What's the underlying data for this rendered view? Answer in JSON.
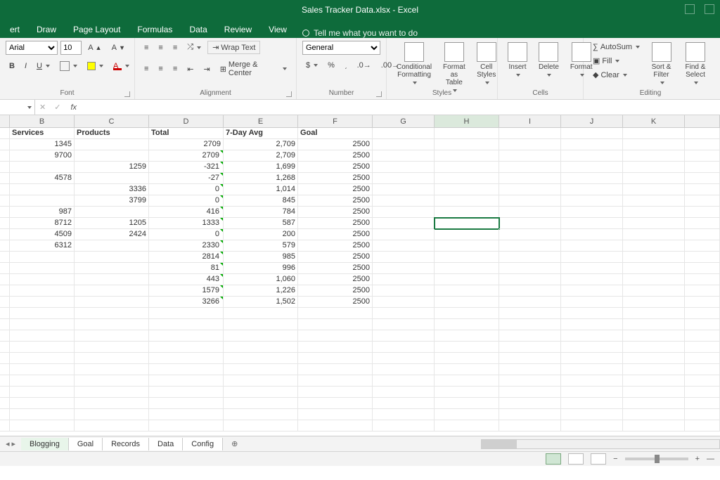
{
  "title": "Sales Tracker Data.xlsx - Excel",
  "menu": {
    "tabs": [
      "ert",
      "Draw",
      "Page Layout",
      "Formulas",
      "Data",
      "Review",
      "View"
    ],
    "tell": "Tell me what you want to do"
  },
  "ribbon": {
    "font": {
      "name": "Arial",
      "size": "10",
      "bold": "B",
      "italic": "I",
      "underline": "U",
      "label": "Font"
    },
    "alignment": {
      "wrap": "Wrap Text",
      "merge": "Merge & Center",
      "label": "Alignment"
    },
    "number": {
      "format": "General",
      "label": "Number"
    },
    "styles": {
      "cond": "Conditional Formatting",
      "fat": "Format as Table",
      "cst": "Cell Styles",
      "label": "Styles"
    },
    "cells": {
      "insert": "Insert",
      "delete": "Delete",
      "format": "Format",
      "label": "Cells"
    },
    "editing": {
      "autosum": "AutoSum",
      "fill": "Fill",
      "clear": "Clear",
      "sort": "Sort & Filter",
      "find": "Find & Select",
      "label": "Editing"
    }
  },
  "formulabar": {
    "name": "",
    "fx": "fx"
  },
  "columns": [
    "B",
    "C",
    "D",
    "E",
    "F",
    "G",
    "H",
    "I",
    "J",
    "K"
  ],
  "headers": {
    "B": "Services",
    "C": "Products",
    "D": "Total",
    "E": "7-Day Avg",
    "F": "Goal"
  },
  "selected": {
    "col": "H",
    "rowIndex": 8
  },
  "rows": [
    {
      "B": "1345",
      "C": "",
      "D": "2709",
      "E": "2,709",
      "F": "2500",
      "triD": false
    },
    {
      "B": "9700",
      "C": "",
      "D": "2709",
      "E": "2,709",
      "F": "2500",
      "triD": true
    },
    {
      "B": "",
      "C": "1259",
      "D": "-321",
      "E": "1,699",
      "F": "2500",
      "triD": true
    },
    {
      "B": "4578",
      "C": "",
      "D": "-27",
      "E": "1,268",
      "F": "2500",
      "triD": true
    },
    {
      "B": "",
      "C": "3336",
      "D": "0",
      "E": "1,014",
      "F": "2500",
      "triD": true
    },
    {
      "B": "",
      "C": "3799",
      "D": "0",
      "E": "845",
      "F": "2500",
      "triD": true
    },
    {
      "B": "987",
      "C": "",
      "D": "416",
      "E": "784",
      "F": "2500",
      "triD": true
    },
    {
      "B": "8712",
      "C": "1205",
      "D": "1333",
      "E": "587",
      "F": "2500",
      "triD": true
    },
    {
      "B": "4509",
      "C": "2424",
      "D": "0",
      "E": "200",
      "F": "2500",
      "triD": true
    },
    {
      "B": "6312",
      "C": "",
      "D": "2330",
      "E": "579",
      "F": "2500",
      "triD": true
    },
    {
      "B": "",
      "C": "",
      "D": "2814",
      "E": "985",
      "F": "2500",
      "triD": true
    },
    {
      "B": "",
      "C": "",
      "D": "81",
      "E": "996",
      "F": "2500",
      "triD": true
    },
    {
      "B": "",
      "C": "",
      "D": "443",
      "E": "1,060",
      "F": "2500",
      "triD": true
    },
    {
      "B": "",
      "C": "",
      "D": "1579",
      "E": "1,226",
      "F": "2500",
      "triD": true
    },
    {
      "B": "",
      "C": "",
      "D": "3266",
      "E": "1,502",
      "F": "2500",
      "triD": true
    }
  ],
  "sheets": [
    "Blogging",
    "Goal",
    "Records",
    "Data",
    "Config"
  ],
  "zoom": "—"
}
